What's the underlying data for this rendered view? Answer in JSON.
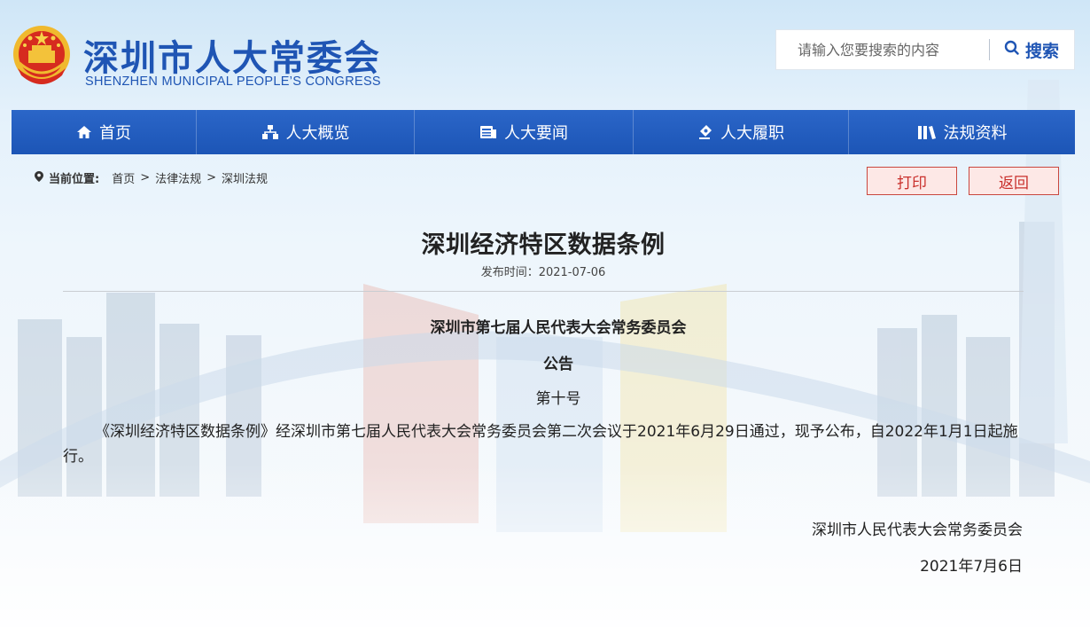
{
  "header": {
    "site_title": "深圳市人大常委会",
    "site_subtitle": "SHENZHEN MUNICIPAL PEOPLE’S CONGRESS",
    "emblem_icon": "national-emblem-icon",
    "search": {
      "placeholder": "请输入您要搜索的内容",
      "button_label": "搜索"
    }
  },
  "nav": {
    "items": [
      {
        "label": "首页",
        "icon": "home-icon"
      },
      {
        "label": "人大概览",
        "icon": "org-chart-icon"
      },
      {
        "label": "人大要闻",
        "icon": "news-icon"
      },
      {
        "label": "人大履职",
        "icon": "duty-icon"
      },
      {
        "label": "法规资料",
        "icon": "books-icon"
      }
    ]
  },
  "breadcrumb": {
    "label": "当前位置:",
    "items": [
      "首页",
      "法律法规",
      "深圳法规"
    ],
    "separator": ">"
  },
  "actions": {
    "print_label": "打印",
    "back_label": "返回"
  },
  "article": {
    "title": "深圳经济特区数据条例",
    "publish_date": "发布时间：2021-07-06",
    "issuer": "深圳市第七届人民代表大会常务委员会",
    "notice": "公告",
    "number": "第十号",
    "body": "《深圳经济特区数据条例》经深圳市第七届人民代表大会常务委员会第二次会议于2021年6月29日通过，现予公布，自2022年1月1日起施行。",
    "signature_org": "深圳市人民代表大会常务委员会",
    "signature_date": "2021年7月6日"
  },
  "colors": {
    "brand_blue": "#1f55b4",
    "nav_blue": "#2b66c8",
    "button_red": "#c9302c",
    "button_bg": "#fde8e6"
  }
}
